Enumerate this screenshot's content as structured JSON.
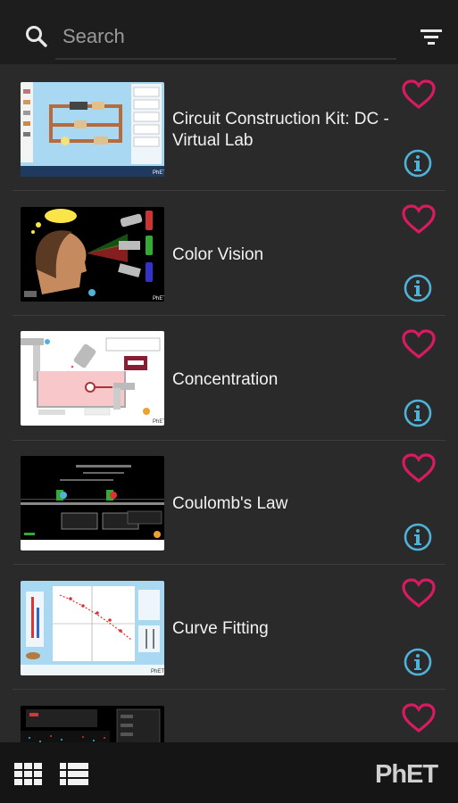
{
  "search": {
    "placeholder": "Search"
  },
  "simulations": [
    {
      "title": "Circuit Construction Kit: DC - Virtual Lab",
      "favorite_icon": "heart-outline-icon",
      "info_icon": "info-icon"
    },
    {
      "title": "Color Vision",
      "favorite_icon": "heart-outline-icon",
      "info_icon": "info-icon"
    },
    {
      "title": "Concentration",
      "favorite_icon": "heart-outline-icon",
      "info_icon": "info-icon"
    },
    {
      "title": "Coulomb's Law",
      "favorite_icon": "heart-outline-icon",
      "info_icon": "info-icon"
    },
    {
      "title": "Curve Fitting",
      "favorite_icon": "heart-outline-icon",
      "info_icon": "info-icon"
    },
    {
      "title": "",
      "favorite_icon": "heart-outline-icon",
      "info_icon": "info-icon"
    }
  ],
  "footer": {
    "brand": "PhET"
  },
  "colors": {
    "heart": "#d81b60",
    "info": "#4fb3d9",
    "topbar": "#1d1d1d",
    "list_bg": "#2a2a2a",
    "bottombar": "#151515"
  }
}
